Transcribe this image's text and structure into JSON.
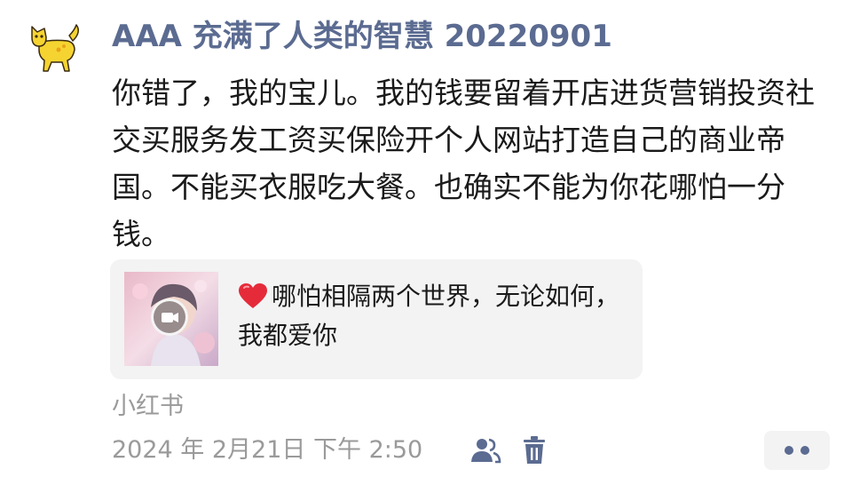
{
  "post": {
    "username": "AAA 充满了人类的智慧 20220901",
    "text": "你错了，我的宝儿。我的钱要留着开店进货营销投资社交买服务发工资买保险开个人网站打造自己的商业帝国。不能买衣服吃大餐。也确实不能为你花哪怕一分钱。",
    "link_card": {
      "text": "哪怕相隔两个世界，无论如何，我都爱你"
    },
    "source": "小红书",
    "timestamp": "2024 年 2月21日 下午 2:50"
  },
  "icons": {
    "avatar": "cat-avatar-icon",
    "video": "video-camera-icon",
    "heart": "red-heart-icon",
    "visibility": "friends-visibility-icon",
    "delete": "trash-icon",
    "more": "more-dots-icon"
  },
  "colors": {
    "username": "#5b6b91",
    "meta_text": "#9a9a9a",
    "card_bg": "#f3f3f3",
    "icon": "#5b6b91"
  }
}
